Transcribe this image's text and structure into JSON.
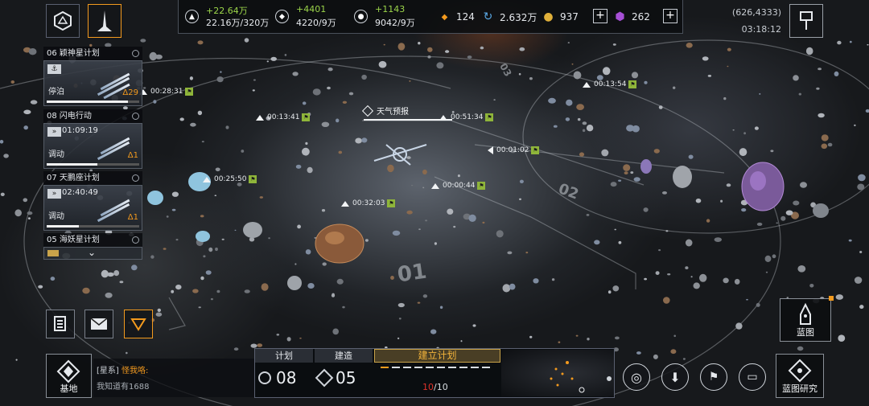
{
  "resources": [
    {
      "icon": "metal-icon",
      "gain": "+22.64万",
      "amount": "22.16万/320万"
    },
    {
      "icon": "crystal-icon",
      "gain": "+4401",
      "amount": "4220/9万"
    },
    {
      "icon": "gas-icon",
      "gain": "+1143",
      "amount": "9042/9万"
    }
  ],
  "currencies": [
    {
      "icon": "credit-icon",
      "value": "124",
      "color": "#f39a1e"
    },
    {
      "icon": "energy-icon",
      "value": "2.632万",
      "color": "#5aa9e6"
    },
    {
      "icon": "gold-coin-icon",
      "value": "937",
      "color": "#e0b03a"
    },
    {
      "icon": "gem-icon",
      "value": "262",
      "color": "#a64fd6"
    }
  ],
  "header": {
    "coordinates": "(626,4333)",
    "clock": "03:18:12"
  },
  "fleets": [
    {
      "index": "06",
      "name": "颖神星计划",
      "icon_label": "⚓",
      "timer": "",
      "state": "停泊",
      "level": "Δ29",
      "progress": 0.88
    },
    {
      "index": "08",
      "name": "闪电行动",
      "icon_label": "»",
      "timer": "01:09:19",
      "state": "调动",
      "level": "Δ1",
      "progress": 0.55
    },
    {
      "index": "07",
      "name": "天鹏座计划",
      "icon_label": "»",
      "timer": "02:40:49",
      "state": "调动",
      "level": "Δ1",
      "progress": 0.35
    },
    {
      "index": "05",
      "name": "海妖星计划",
      "icon_label": "",
      "timer": "",
      "state": "",
      "level": "",
      "progress": 0
    }
  ],
  "map": {
    "weather": "天气预报",
    "markers": [
      {
        "time": "00:28:31",
        "type": "chev"
      },
      {
        "time": "00:13:41",
        "type": "chev"
      },
      {
        "time": "00:51:34",
        "type": "chev"
      },
      {
        "time": "00:13:54",
        "type": "chev"
      },
      {
        "time": "00:01:02",
        "type": "left"
      },
      {
        "time": "00:25:50",
        "type": "chev"
      },
      {
        "time": "00:00:44",
        "type": "chev"
      },
      {
        "time": "00:32:03",
        "type": "chev"
      }
    ],
    "zones": [
      "01",
      "02",
      "03"
    ]
  },
  "base": {
    "label": "基地"
  },
  "chat": {
    "channel": "[星系]",
    "sender": "怪我咯:",
    "message": "我知道有1688"
  },
  "plan": {
    "tab_plan": "计划",
    "tab_build": "建造",
    "plan_count": "08",
    "build_count": "05",
    "build_title": "建立计划",
    "progress_current": "10",
    "progress_total": "/10",
    "slots": 10
  },
  "right": {
    "blueprint_label": "蓝图",
    "research_label": "蓝图研究"
  }
}
